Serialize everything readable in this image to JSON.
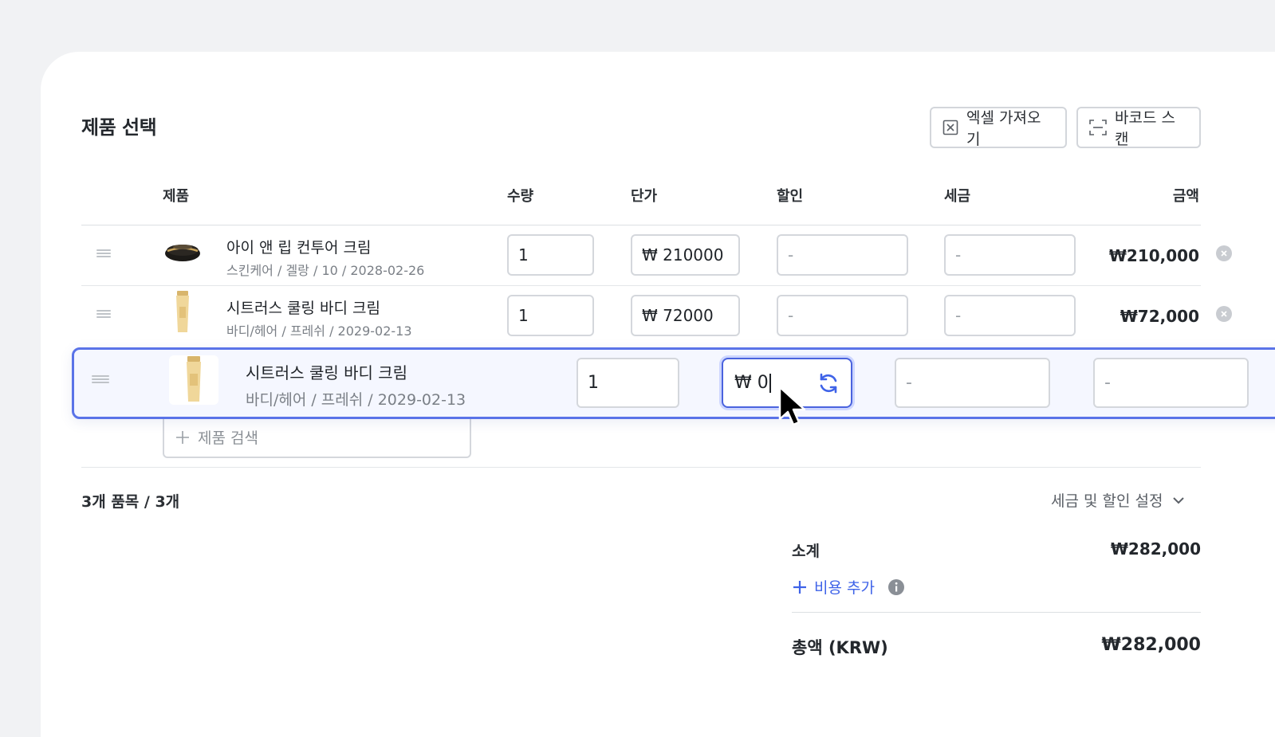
{
  "header": {
    "title": "제품 선택",
    "excel_import_label": "엑셀 가져오기",
    "barcode_scan_label": "바코드 스캔"
  },
  "table": {
    "columns": [
      "제품",
      "수량",
      "단가",
      "할인",
      "세금",
      "금액"
    ],
    "rows": [
      {
        "name": "아이 앤 립 컨투어 크림",
        "meta": "스킨케어 / 겔랑 / 10 / 2028-02-26",
        "quantity": "1",
        "unit_price": "₩ 210000",
        "discount": "-",
        "tax": "-",
        "amount": "₩210,000"
      },
      {
        "name": "시트러스 쿨링 바디 크림",
        "meta": "바디/헤어 / 프레쉬 / 2029-02-13",
        "quantity": "1",
        "unit_price": "₩ 72000",
        "discount": "-",
        "tax": "-",
        "amount": "₩72,000"
      }
    ],
    "dragging_row": {
      "name": "시트러스 쿨링 바디 크림",
      "meta": "바디/헤어 / 프레쉬 / 2029-02-13",
      "quantity": "1",
      "unit_price": "₩ 0",
      "discount": "-",
      "tax": "-"
    },
    "search_placeholder": "제품 검색"
  },
  "footer": {
    "item_count": "3개 품목 / 3개",
    "tax_discount_settings": "세금 및 할인 설정",
    "subtotal_label": "소계",
    "subtotal_value": "₩282,000",
    "add_cost_label": "비용 추가",
    "total_label": "총액 (KRW)",
    "total_value": "₩282,000"
  },
  "colors": {
    "accent": "#4a63de",
    "link": "#3f63e8",
    "drag_row_border": "#5a73e8"
  }
}
